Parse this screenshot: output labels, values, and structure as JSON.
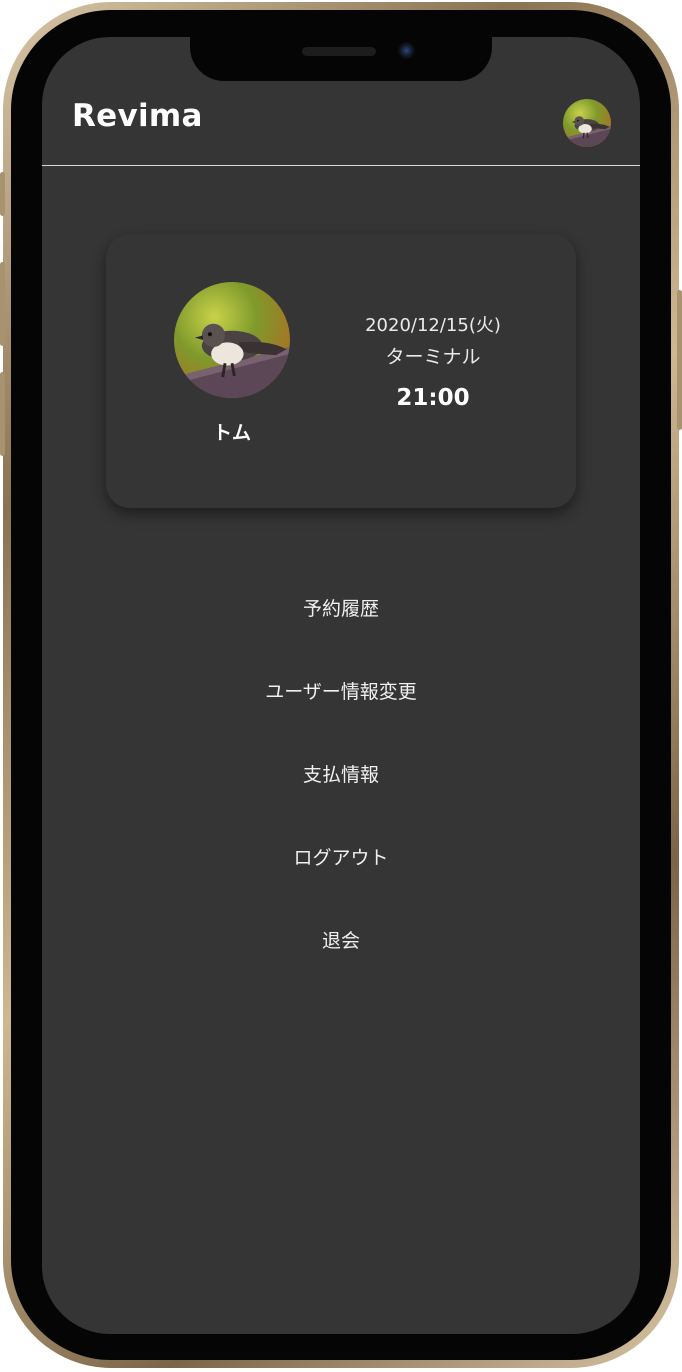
{
  "header": {
    "app_title": "Revima"
  },
  "profile_card": {
    "user_name": "トム",
    "reservation": {
      "date": "2020/12/15(火)",
      "place": "ターミナル",
      "time": "21:00"
    }
  },
  "menu": {
    "items": [
      {
        "label": "予約履歴"
      },
      {
        "label": "ユーザー情報変更"
      },
      {
        "label": "支払情報"
      },
      {
        "label": "ログアウト"
      },
      {
        "label": "退会"
      }
    ]
  },
  "icons": {
    "avatar": "bird-photo-avatar-icon"
  },
  "colors": {
    "screen_background": "#353535",
    "text": "#ffffff",
    "divider": "#d8d8d8",
    "phone_frame_gold": "#c8b38e"
  }
}
